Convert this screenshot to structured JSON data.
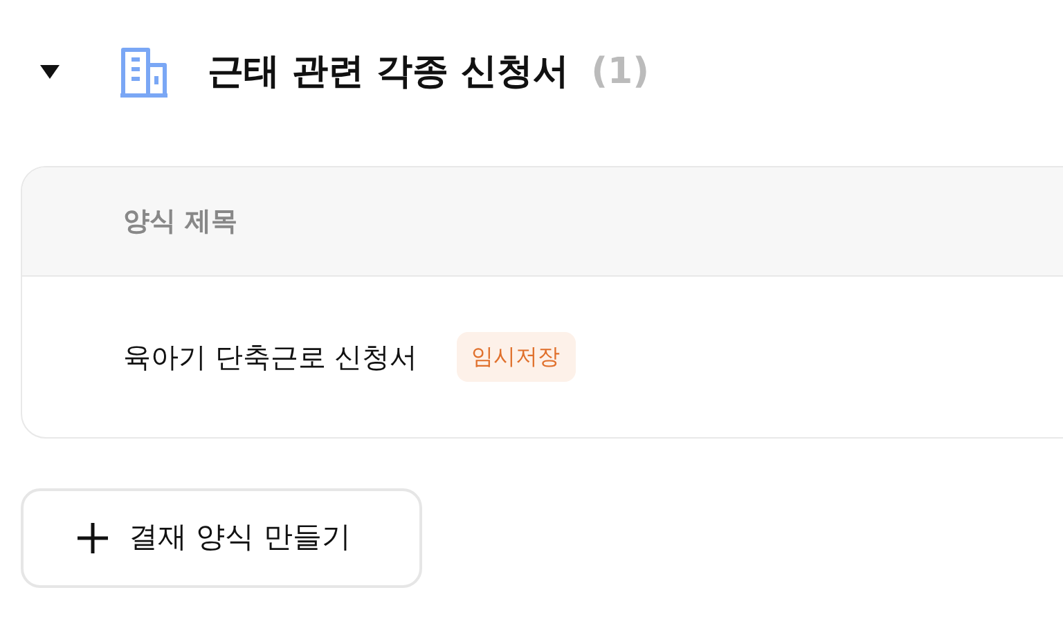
{
  "section": {
    "title": "근태 관련 각종 신청서",
    "count": "(1)",
    "expanded": true
  },
  "table": {
    "columns": [
      "양식 제목"
    ],
    "rows": [
      {
        "title": "육아기 단축근로 신청서",
        "badge": "임시저장"
      }
    ]
  },
  "create_button": {
    "label": "결재 양식 만들기"
  }
}
